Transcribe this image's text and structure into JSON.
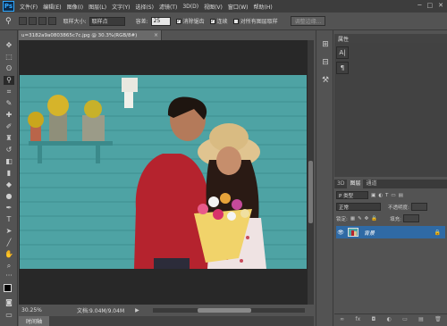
{
  "app": {
    "logo_text": "Ps",
    "menus": [
      "文件(F)",
      "编辑(E)",
      "图像(I)",
      "图层(L)",
      "文字(Y)",
      "选择(S)",
      "滤镜(T)",
      "3D(D)",
      "视图(V)",
      "窗口(W)",
      "帮助(H)"
    ],
    "window_controls": [
      "─",
      "□",
      "✕"
    ]
  },
  "options_bar": {
    "sample_size_label": "取样大小:",
    "sample_size_value": "取样点",
    "tolerance_label": "容差:",
    "tolerance_value": "25",
    "antialias_label": "消除锯齿",
    "contiguous_label": "连续",
    "all_layers_label": "对所有图层取样",
    "refine_edge_label": "调整边缘..."
  },
  "document": {
    "tab_label": "u=3182a9a0803865c7c.jpg @ 30.3%(RGB/8#)",
    "close": "×",
    "zoom": "30.25%",
    "doc_info": "文档:9.04M/9.04M",
    "play": "▶"
  },
  "timeline_tab": "时间轴",
  "properties": {
    "tab_label": "属性",
    "icons": [
      "A|",
      "¶"
    ]
  },
  "layers": {
    "tabs": [
      "3D",
      "图层",
      "通道"
    ],
    "active_tab": 1,
    "kind_label": "P 类型",
    "blend_mode": "正常",
    "opacity_label": "不透明度:",
    "lock_label": "锁定:",
    "fill_label": "填充:",
    "layer_name": "背景",
    "footer_icons": [
      "∞",
      "fx",
      "◘",
      "◐",
      "▭",
      "▤",
      "🗑"
    ]
  },
  "colors": {
    "teal_wall": "#4ea3a4",
    "selected_layer": "#2f6aa5",
    "panel_bg": "#535353",
    "canvas_bg": "#282828"
  }
}
